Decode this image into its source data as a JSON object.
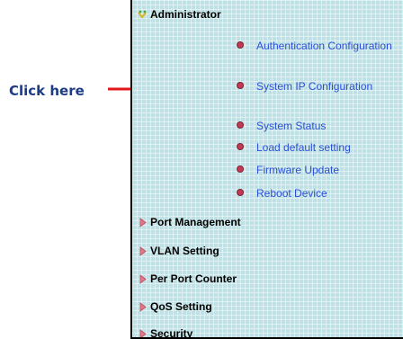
{
  "annotation": {
    "label": "Click here"
  },
  "menu": {
    "administrator": {
      "label": "Administrator",
      "items": [
        {
          "label": "Authentication Configuration"
        },
        {
          "label": "System IP Configuration"
        },
        {
          "label": "System Status"
        },
        {
          "label": "Load default setting"
        },
        {
          "label": "Firmware Update"
        },
        {
          "label": "Reboot Device"
        }
      ]
    },
    "sections": [
      {
        "label": "Port Management"
      },
      {
        "label": "VLAN Setting"
      },
      {
        "label": "Per Port Counter"
      },
      {
        "label": "QoS Setting"
      },
      {
        "label": "Security"
      }
    ]
  },
  "colors": {
    "panel_bg": "#bfe1e5",
    "link": "#2a4fd6",
    "bullet": "#c23a54",
    "annotation_text": "#1c3d86",
    "annotation_arrow": "#e0161b"
  },
  "icons": {
    "administrator": "expanded-folder-icon",
    "section": "collapsed-arrow-icon",
    "sub_item": "bullet-icon"
  }
}
